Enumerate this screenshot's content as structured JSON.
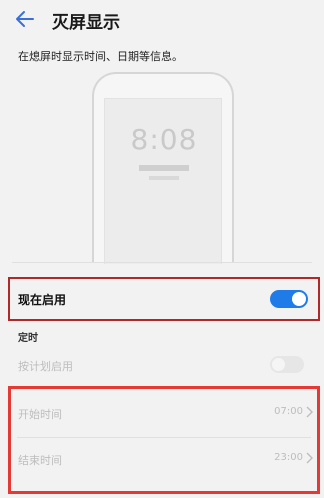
{
  "header": {
    "title": "灭屏显示",
    "back_icon": "arrow-left-icon"
  },
  "description": "在熄屏时显示时间、日期等信息。",
  "preview": {
    "clock": "8:08"
  },
  "now_enabled": {
    "label": "现在启用",
    "toggle_state": "on",
    "accent_color": "#1e7be8"
  },
  "schedule": {
    "section_label": "定时",
    "enable_label": "按计划启用",
    "toggle_state": "off",
    "start": {
      "label": "开始时间",
      "value": "07:00"
    },
    "end": {
      "label": "结束时间",
      "value": "23:00"
    }
  },
  "colors": {
    "highlight_red": "#e53935",
    "highlight_dark_red": "#b02828"
  }
}
